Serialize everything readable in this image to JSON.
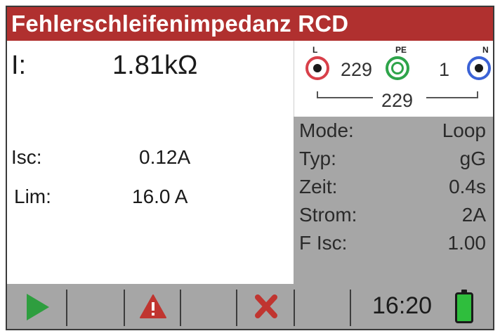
{
  "window": {
    "title": "Fehlerschleifenimpedanz RCD"
  },
  "measurement": {
    "main_label": "I:",
    "main_value": "1.81kΩ",
    "isc_label": "Isc:",
    "isc_value": "0.12A",
    "lim_label": "Lim:",
    "lim_value": "16.0 A"
  },
  "terminals": {
    "l_label": "L",
    "pe_label": "PE",
    "n_label": "N",
    "l_pe_value": "229",
    "pe_n_value": "1",
    "l_n_value": "229"
  },
  "params": [
    {
      "key": "Mode:",
      "value": "Loop"
    },
    {
      "key": "Typ:",
      "value": "gG"
    },
    {
      "key": "Zeit:",
      "value": "0.4s"
    },
    {
      "key": "Strom:",
      "value": "2A"
    },
    {
      "key": "F Isc:",
      "value": "1.00"
    }
  ],
  "status": {
    "time": "16:20",
    "battery_level": 1.0
  },
  "icons": {
    "start": "play-icon",
    "warning": "warning-icon",
    "cancel": "cancel-x-icon",
    "battery": "battery-icon"
  },
  "colors": {
    "title_bg": "#b0302f",
    "panel_gray": "#a6a6a6",
    "terminal_l": "#d8404a",
    "terminal_pe": "#2ea44a",
    "terminal_n": "#3b62d6",
    "play_green": "#2e9e3f",
    "warn_red": "#c03530",
    "battery_green": "#2fbe3d"
  }
}
